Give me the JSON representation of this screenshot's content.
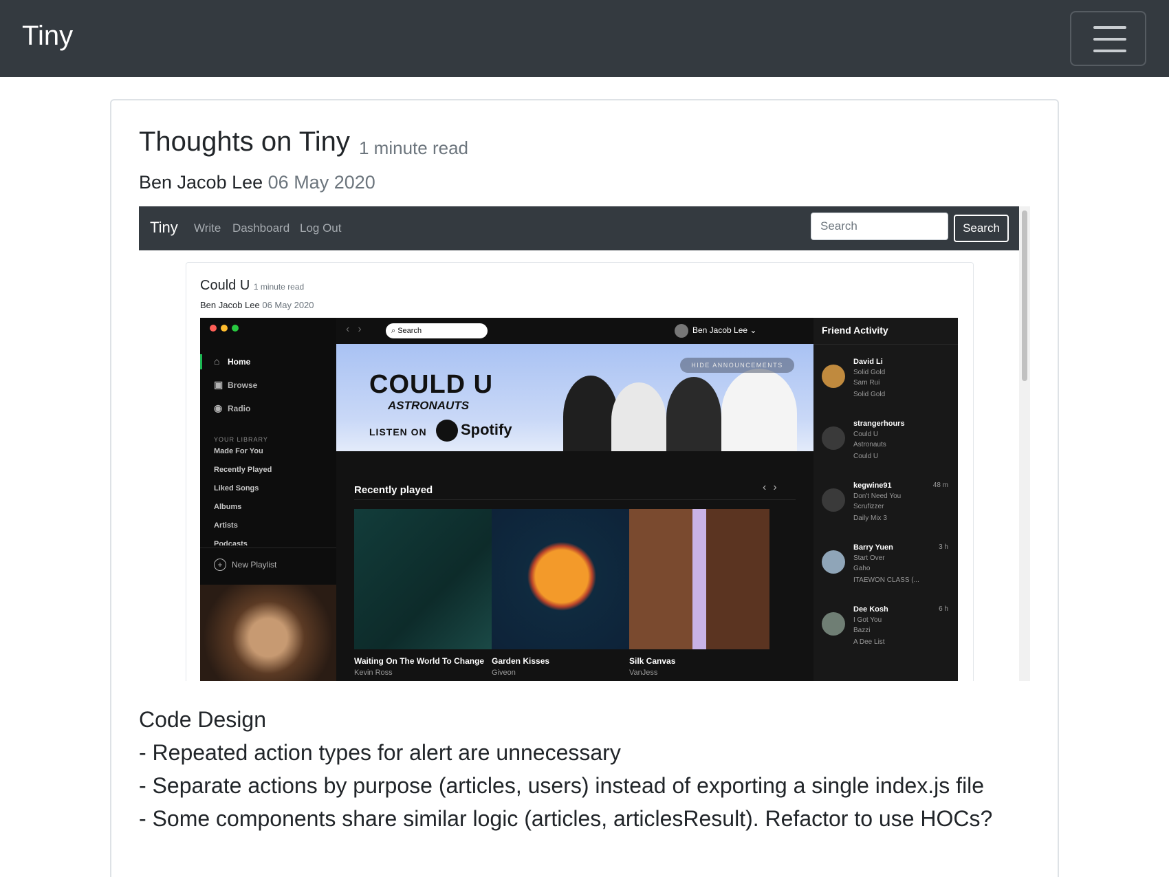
{
  "navbar": {
    "brand": "Tiny"
  },
  "post": {
    "title": "Thoughts on Tiny",
    "read_time": "1 minute read",
    "author": "Ben Jacob Lee",
    "date": "06 May 2020",
    "body_heading": "Code Design",
    "body_lines": [
      "- Repeated action types for alert are unnecessary",
      "- Separate actions by purpose (articles, users) instead of exporting a single index.js file",
      "- Some components share similar logic (articles, articlesResult). Refactor to use HOCs?"
    ]
  },
  "screenshot": {
    "nav": {
      "brand": "Tiny",
      "links": [
        "Write",
        "Dashboard",
        "Log Out"
      ],
      "search_placeholder": "Search",
      "search_button": "Search"
    },
    "article": {
      "title": "Could U",
      "read_time": "1 minute read",
      "author": "Ben Jacob Lee",
      "date": "06 May 2020"
    },
    "spotify": {
      "sidebar": {
        "nav": [
          "Home",
          "Browse",
          "Radio"
        ],
        "library_heading": "YOUR LIBRARY",
        "library": [
          "Made For You",
          "Recently Played",
          "Liked Songs",
          "Albums",
          "Artists",
          "Podcasts"
        ],
        "new_playlist": "New Playlist"
      },
      "search": "Search",
      "user": "Ben Jacob Lee",
      "banner": {
        "title": "COULD U",
        "subtitle": "ASTRONAUTS",
        "listen_on": "LISTEN ON",
        "service": "Spotify",
        "hide": "HIDE ANNOUNCEMENTS"
      },
      "recently_played": {
        "heading": "Recently played",
        "items": [
          {
            "title": "Waiting On The World To Change",
            "artist": "Kevin Ross"
          },
          {
            "title": "Garden Kisses",
            "artist": "Giveon"
          },
          {
            "title": "Silk Canvas",
            "artist": "VanJess"
          }
        ]
      },
      "friend_activity": {
        "heading": "Friend Activity",
        "friends": [
          {
            "name": "David Li",
            "track": "Solid Gold",
            "artist": "Sam Rui",
            "context": "Solid Gold",
            "time": ""
          },
          {
            "name": "strangerhours",
            "track": "Could U",
            "artist": "Astronauts",
            "context": "Could U",
            "time": ""
          },
          {
            "name": "kegwine91",
            "track": "Don't Need You",
            "artist": "Scrufizzer",
            "context": "Daily Mix 3",
            "time": "48 m"
          },
          {
            "name": "Barry Yuen",
            "track": "Start Over",
            "artist": "Gaho",
            "context": "ITAEWON CLASS (...",
            "time": "3 h"
          },
          {
            "name": "Dee Kosh",
            "track": "I Got You",
            "artist": "Bazzi",
            "context": "A Dee List",
            "time": "6 h"
          }
        ]
      }
    }
  }
}
